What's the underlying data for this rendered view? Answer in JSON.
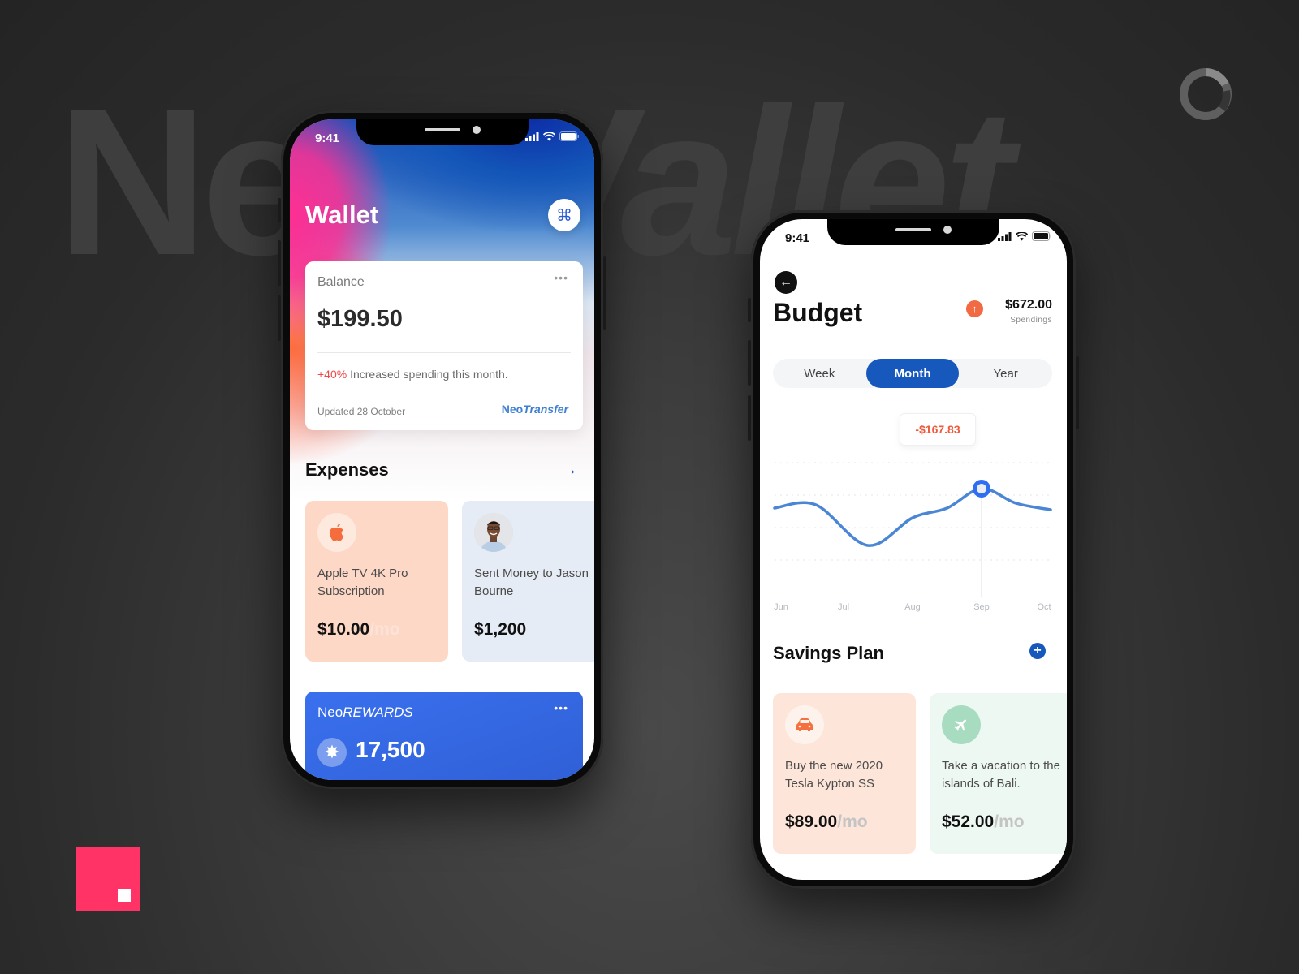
{
  "background": {
    "title_upright": "Neo",
    "title_italic": "Wallet",
    "brand_color": "#ff3366"
  },
  "wallet_phone": {
    "status": {
      "time": "9:41"
    },
    "title": "Wallet",
    "command_icon": "command-icon",
    "balance_card": {
      "label": "Balance",
      "more": "•••",
      "amount": "$199.50",
      "change_pct": "+40%",
      "change_text": " Increased spending this month.",
      "updated": "Updated 28 October",
      "transfer_prefix": "Neo",
      "transfer_suffix": "Transfer"
    },
    "expenses": {
      "title": "Expenses",
      "arrow": "→",
      "items": [
        {
          "icon": "apple-icon",
          "desc": "Apple TV 4K Pro Subscription",
          "amount": "$10.00",
          "period": "/mo",
          "bg": "#fdd8c7"
        },
        {
          "icon": "avatar",
          "desc": "Sent Money to Jason Bourne",
          "amount": "$1,200",
          "period": "",
          "bg": "#e6ecf5"
        }
      ]
    },
    "rewards": {
      "prefix": "Neo",
      "suffix": "REWARDS",
      "more": "•••",
      "points": "17,500"
    }
  },
  "budget_phone": {
    "status": {
      "time": "9:41"
    },
    "title": "Budget",
    "spend_amount": "$672.00",
    "spend_label": "Spendings",
    "tabs": [
      {
        "label": "Week",
        "active": false
      },
      {
        "label": "Month",
        "active": true
      },
      {
        "label": "Year",
        "active": false
      }
    ],
    "tooltip": "-$167.83",
    "savings": {
      "title": "Savings Plan",
      "add": "+",
      "items": [
        {
          "icon": "car-icon",
          "desc": "Buy the new 2020 Tesla Kypton SS",
          "amount": "$89.00",
          "period": "/mo",
          "bg": "#fde5da",
          "icon_bg": "#fef2ec",
          "icon_color": "#f4703f"
        },
        {
          "icon": "airplane-icon",
          "desc": "Take a vacation to the islands of Bali.",
          "amount": "$52.00",
          "period": "/mo",
          "bg": "#eef8f2",
          "icon_bg": "#a8dcc0",
          "icon_color": "#ffffff"
        }
      ]
    }
  },
  "chart_data": {
    "type": "line",
    "title": "",
    "categories": [
      "Jun",
      "Jul",
      "Aug",
      "Sep",
      "Oct"
    ],
    "x": [
      0,
      0.6,
      1.35,
      2,
      2.5,
      3,
      3.5,
      4
    ],
    "values": [
      2.6,
      2.7,
      1.45,
      2.3,
      2.6,
      3.2,
      2.75,
      2.55
    ],
    "highlight": {
      "category": "Sep",
      "label": "-$167.83"
    },
    "ylim": [
      0,
      4
    ],
    "grid": true,
    "legend": "none",
    "line_color": "#4a86d4"
  }
}
